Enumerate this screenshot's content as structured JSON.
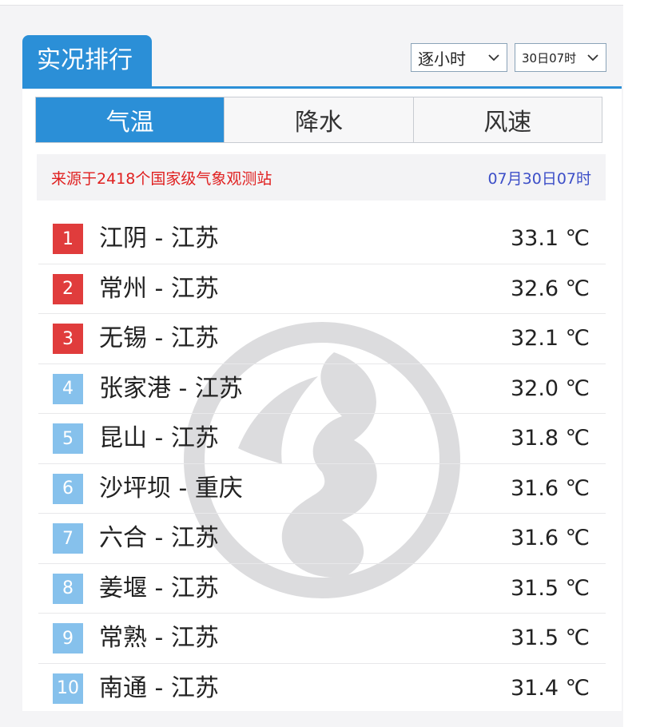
{
  "panel": {
    "title": "实况排行",
    "interval_select": "逐小时",
    "time_select": "30日07时"
  },
  "tabs": [
    {
      "label": "气温",
      "active": true
    },
    {
      "label": "降水",
      "active": false
    },
    {
      "label": "风速",
      "active": false
    }
  ],
  "source": {
    "text": "来源于2418个国家级气象观测站",
    "time": "07月30日07时"
  },
  "colors": {
    "accent": "#2b8fd7",
    "top_rank": "#e03c3c",
    "other_rank": "#86c1ec",
    "source_text": "#e02020",
    "time_text": "#3d4fc8"
  },
  "icons": {
    "dropdown": "chevron-down-icon",
    "watermark": "logo-watermark"
  },
  "rankings": [
    {
      "rank": "1",
      "station": "江阴 - 江苏",
      "temp": "33.1 ℃",
      "top": true
    },
    {
      "rank": "2",
      "station": "常州 - 江苏",
      "temp": "32.6 ℃",
      "top": true
    },
    {
      "rank": "3",
      "station": "无锡 - 江苏",
      "temp": "32.1 ℃",
      "top": true
    },
    {
      "rank": "4",
      "station": "张家港 - 江苏",
      "temp": "32.0 ℃",
      "top": false
    },
    {
      "rank": "5",
      "station": "昆山 - 江苏",
      "temp": "31.8 ℃",
      "top": false
    },
    {
      "rank": "6",
      "station": "沙坪坝 - 重庆",
      "temp": "31.6 ℃",
      "top": false
    },
    {
      "rank": "7",
      "station": "六合 - 江苏",
      "temp": "31.6 ℃",
      "top": false
    },
    {
      "rank": "8",
      "station": "姜堰 - 江苏",
      "temp": "31.5 ℃",
      "top": false
    },
    {
      "rank": "9",
      "station": "常熟 - 江苏",
      "temp": "31.5 ℃",
      "top": false
    },
    {
      "rank": "10",
      "station": "南通 - 江苏",
      "temp": "31.4 ℃",
      "top": false
    }
  ]
}
